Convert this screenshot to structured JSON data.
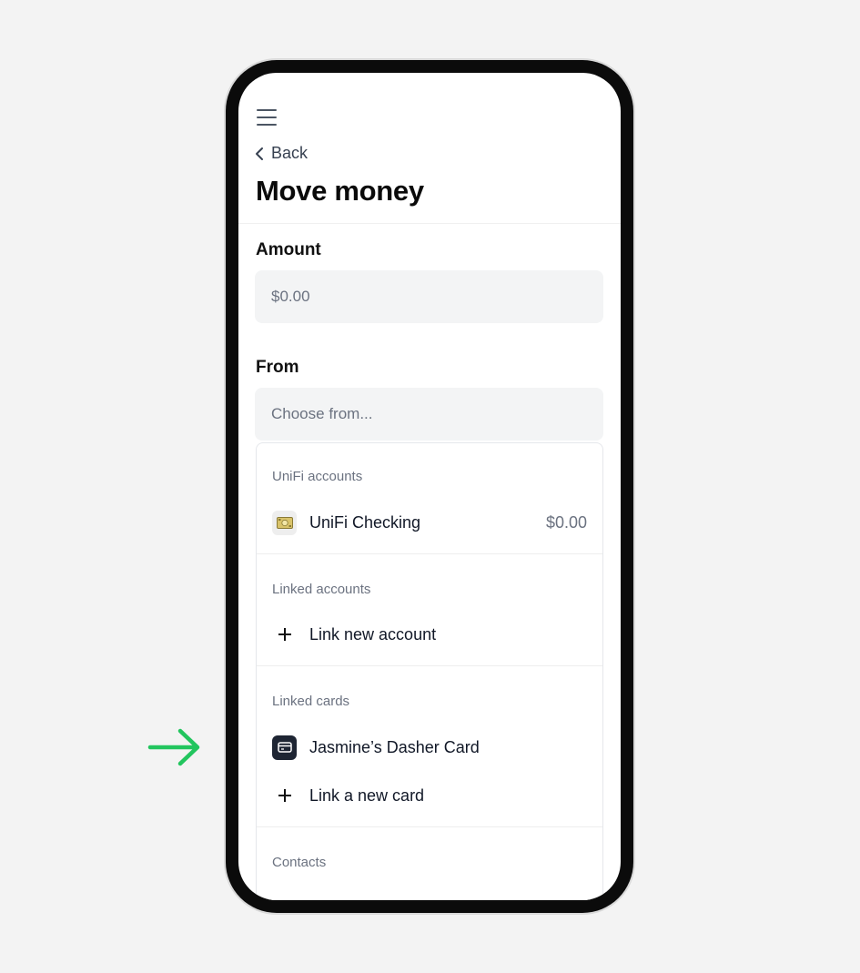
{
  "header": {
    "back_label": "Back",
    "title": "Move money"
  },
  "amount": {
    "label": "Amount",
    "placeholder": "$0.00"
  },
  "from": {
    "label": "From",
    "placeholder": "Choose from..."
  },
  "groups": {
    "unifi": {
      "title": "UniFi accounts",
      "items": [
        {
          "label": "UniFi Checking",
          "amount": "$0.00",
          "icon": "cash-icon"
        }
      ]
    },
    "linked_accounts": {
      "title": "Linked accounts",
      "add_label": "Link new account"
    },
    "linked_cards": {
      "title": "Linked cards",
      "items": [
        {
          "label": "Jasmine’s Dasher Card",
          "icon": "card-icon"
        }
      ],
      "add_label": "Link a new card"
    },
    "contacts": {
      "title": "Contacts"
    }
  },
  "colors": {
    "accent_arrow": "#22c55e",
    "card_icon_bg": "#1e2533",
    "field_bg": "#f3f4f5"
  }
}
